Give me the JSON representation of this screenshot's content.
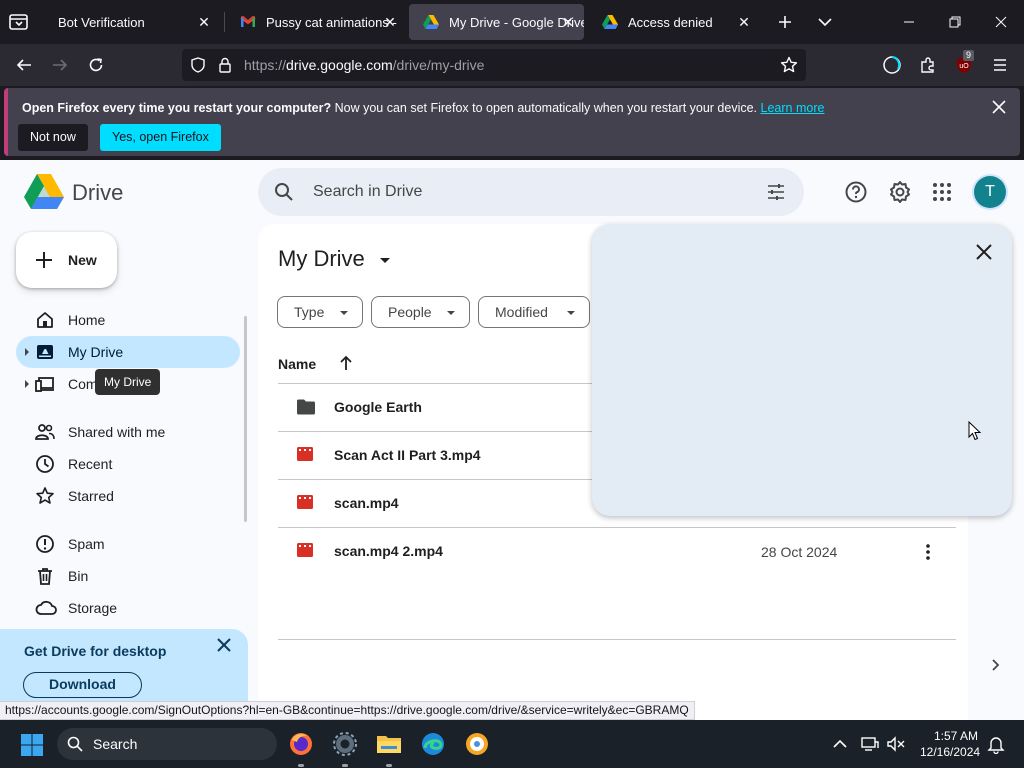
{
  "browser": {
    "tabs": [
      {
        "title": "Bot Verification",
        "favicon": "page-icon",
        "active": false
      },
      {
        "title": "Pussy cat animations - ",
        "favicon": "gmail-icon",
        "active": false
      },
      {
        "title": "My Drive - Google Drive",
        "favicon": "google-drive-icon",
        "active": true
      },
      {
        "title": "Access denied",
        "favicon": "google-drive-icon",
        "active": false
      }
    ],
    "url_prefix": "https://",
    "url_domain": "drive.google.com",
    "url_path": "/drive/my-drive",
    "extensions_badge": "9",
    "notification": {
      "bold_text": "Open Firefox every time you restart your computer?",
      "text": " Now you can set Firefox to open automatically when you restart your device. ",
      "link": "Learn more",
      "not_now": "Not now",
      "yes": "Yes, open Firefox"
    },
    "status_url": "https://accounts.google.com/SignOutOptions?hl=en-GB&continue=https://drive.google.com/drive/&service=writely&ec=GBRAMQ"
  },
  "drive": {
    "app_name": "Drive",
    "search_placeholder": "Search in Drive",
    "avatar_letter": "T",
    "new_label": "New",
    "nav": [
      {
        "label": "Home",
        "icon": "home-icon"
      },
      {
        "label": "My Drive",
        "icon": "my-drive-icon"
      },
      {
        "label": "Computers",
        "icon": "computers-icon"
      },
      {
        "label": "Shared with me",
        "icon": "shared-icon"
      },
      {
        "label": "Recent",
        "icon": "clock-icon"
      },
      {
        "label": "Starred",
        "icon": "star-icon"
      },
      {
        "label": "Spam",
        "icon": "spam-icon"
      },
      {
        "label": "Bin",
        "icon": "bin-icon"
      },
      {
        "label": "Storage",
        "icon": "cloud-icon"
      }
    ],
    "nav_computers_visible": "Com",
    "tooltip": "My Drive",
    "promo": {
      "title": "Get Drive for desktop",
      "download": "Download"
    },
    "page_title": "My Drive",
    "filters": [
      "Type",
      "People",
      "Modified"
    ],
    "column_name": "Name",
    "files": [
      {
        "name": "Google Earth",
        "type": "folder",
        "date": ""
      },
      {
        "name": "Scan Act II Part 3.mp4",
        "type": "video",
        "date": ""
      },
      {
        "name": "scan.mp4",
        "type": "video",
        "date": ""
      },
      {
        "name": "scan.mp4 2.mp4",
        "type": "video",
        "date": "28 Oct 2024"
      }
    ]
  },
  "taskbar": {
    "search_label": "Search",
    "time": "1:57 AM",
    "date": "12/16/2024"
  },
  "colors": {
    "selected_nav": "#c2e7ff",
    "avatar": "#12838d",
    "video_icon": "#d93025",
    "notif_accent": "#00ddff"
  }
}
